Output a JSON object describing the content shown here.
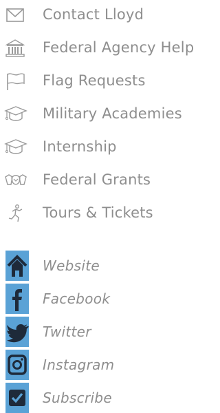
{
  "menu": {
    "items": [
      {
        "label": "Contact Lloyd",
        "icon": "envelope-icon"
      },
      {
        "label": "Federal Agency Help",
        "icon": "government-building-icon"
      },
      {
        "label": "Flag Requests",
        "icon": "flag-icon"
      },
      {
        "label": "Military Academies",
        "icon": "graduation-cap-icon"
      },
      {
        "label": "Internship",
        "icon": "graduation-cap-icon"
      },
      {
        "label": "Federal Grants",
        "icon": "handshake-icon"
      },
      {
        "label": "Tours & Tickets",
        "icon": "running-figure-icon"
      }
    ]
  },
  "social": {
    "items": [
      {
        "label": "Website",
        "icon": "home-icon"
      },
      {
        "label": "Facebook",
        "icon": "facebook-icon"
      },
      {
        "label": "Twitter",
        "icon": "twitter-icon"
      },
      {
        "label": "Instagram",
        "icon": "instagram-icon"
      },
      {
        "label": "Subscribe",
        "icon": "checkbox-icon"
      }
    ]
  },
  "colors": {
    "text": "#8e8e8e",
    "icon_gray": "#9a9a9a",
    "social_bg": "#5aa2d6",
    "social_glyph": "#1e2a3a"
  }
}
